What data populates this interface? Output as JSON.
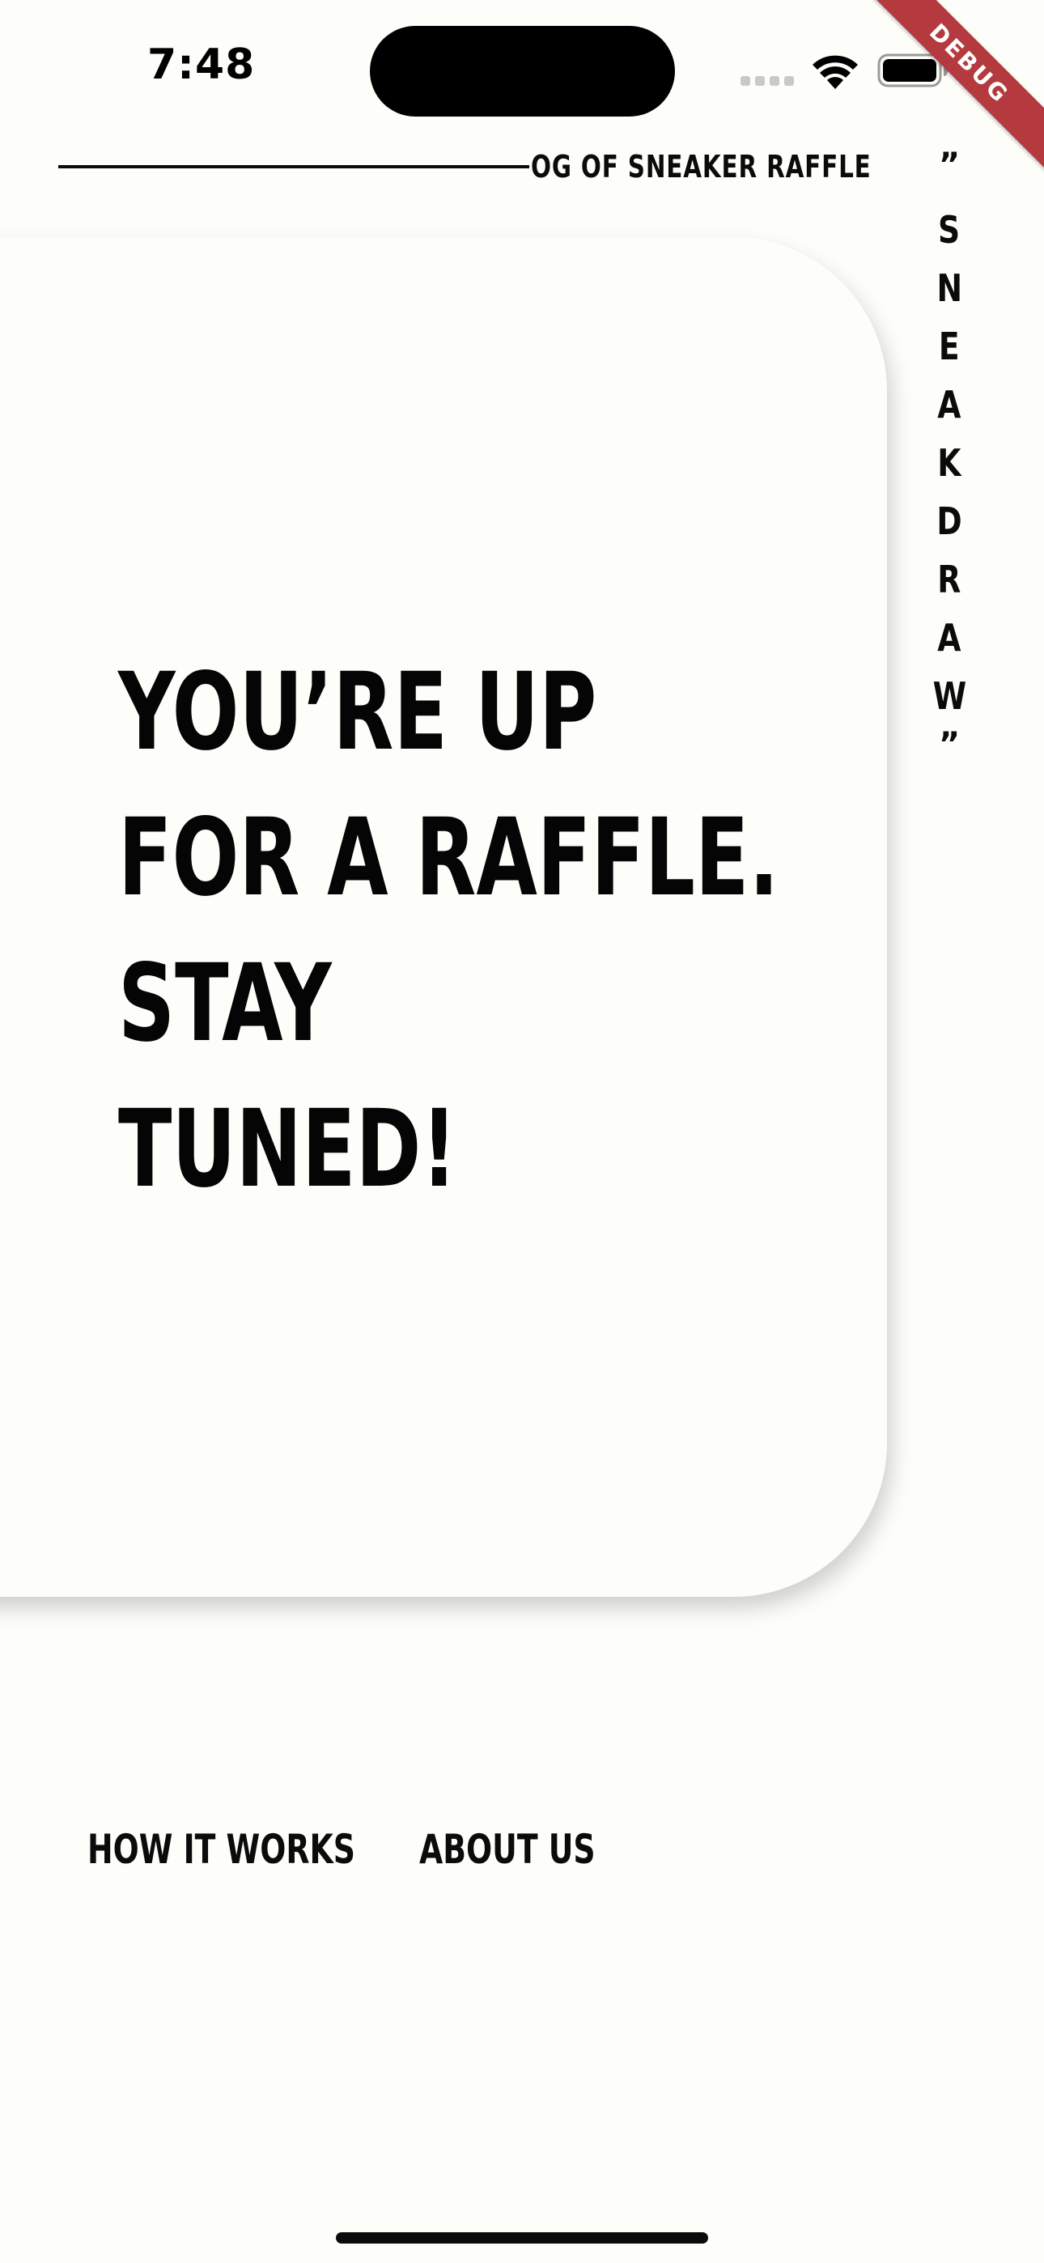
{
  "status_bar": {
    "time": "7:48"
  },
  "debug_banner": {
    "label": "DEBUG"
  },
  "header": {
    "title": "OG OF SNEAKER RAFFLE"
  },
  "brand": {
    "open_quote": "”",
    "letters": [
      "S",
      "N",
      "E",
      "A",
      "K",
      "D",
      "R",
      "A",
      "W"
    ],
    "close_quote": "”"
  },
  "hero": {
    "lines": [
      "YOU’RE UP",
      "FOR A RAFFLE.",
      "STAY",
      "TUNED!"
    ]
  },
  "nav": {
    "how_it_works": "HOW IT WORKS",
    "about_us": "ABOUT US"
  },
  "colors": {
    "background": "#FDFDF9",
    "text": "#0B0B0B",
    "debug_banner": "#B43A3F"
  },
  "icons": {
    "signal": "cell-signal-icon",
    "wifi": "wifi-icon",
    "battery": "battery-icon"
  }
}
